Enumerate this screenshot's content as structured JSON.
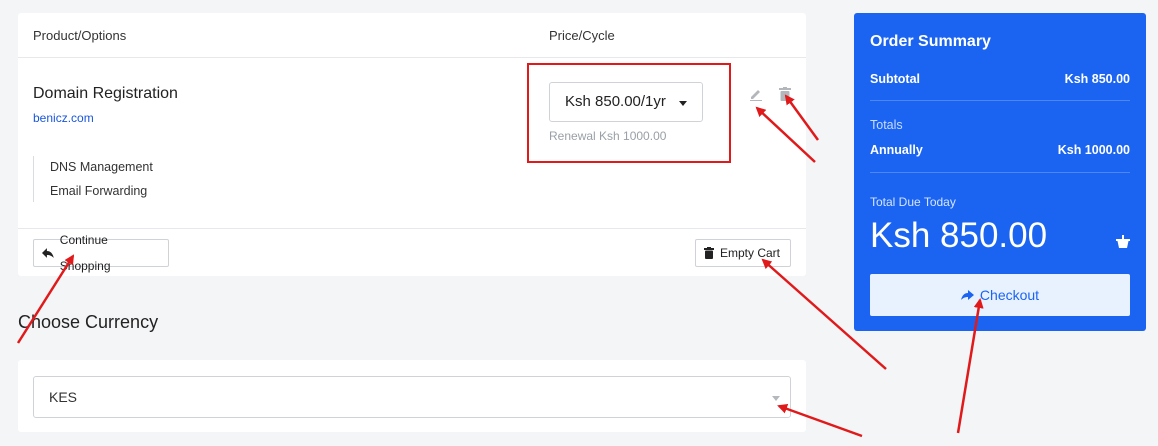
{
  "cart": {
    "header": {
      "product_col": "Product/Options",
      "price_col": "Price/Cycle"
    },
    "item": {
      "name": "Domain Registration",
      "domain": "benicz.com",
      "addons": [
        "DNS Management",
        "Email Forwarding"
      ],
      "price_cycle": "Ksh 850.00/1yr",
      "renewal": "Renewal Ksh 1000.00"
    },
    "footer": {
      "continue_label": "Continue Shopping",
      "empty_label": "Empty Cart"
    }
  },
  "currency": {
    "title": "Choose Currency",
    "selected": "KES"
  },
  "summary": {
    "title": "Order Summary",
    "subtotal_label": "Subtotal",
    "subtotal_value": "Ksh 850.00",
    "totals_label": "Totals",
    "annual_label": "Annually",
    "annual_value": "Ksh 1000.00",
    "due_label": "Total Due Today",
    "due_amount": "Ksh 850.00",
    "checkout_label": "Checkout"
  },
  "icons": [
    "edit-icon",
    "trash-icon",
    "back-arrow-icon",
    "basket-icon",
    "forward-arrow-icon"
  ],
  "colors": {
    "accent": "#1b64f2",
    "annotation": "#e0191a",
    "link": "#1a56db"
  }
}
